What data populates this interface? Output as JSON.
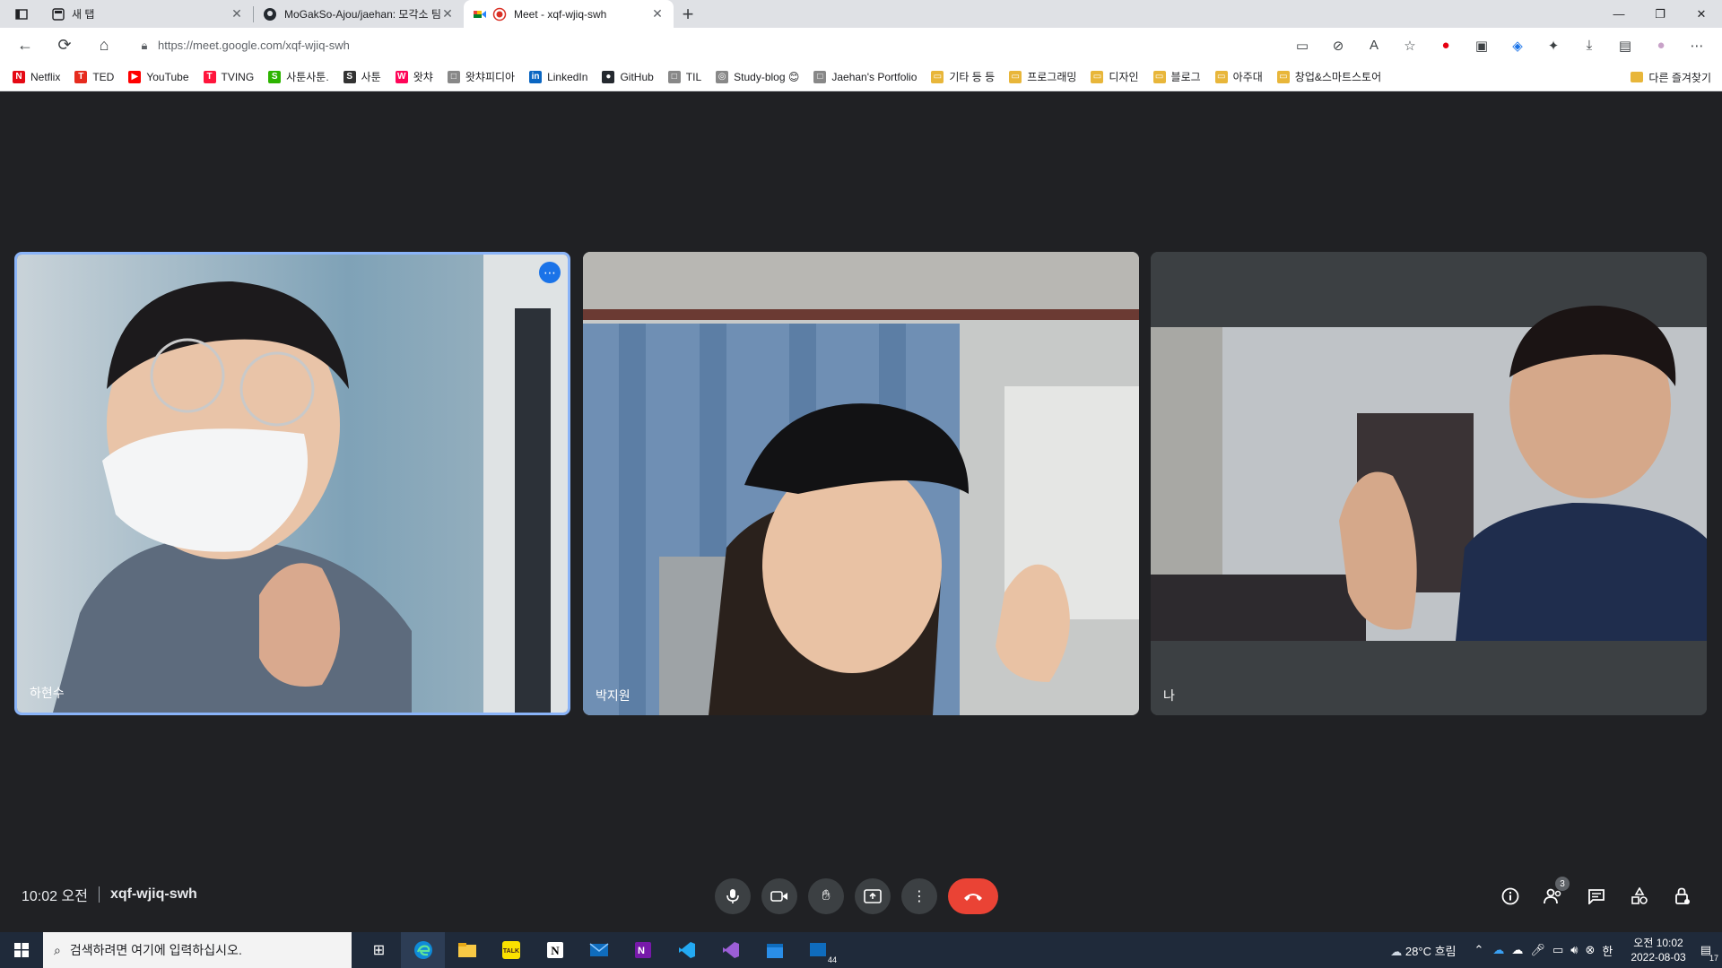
{
  "tabs": [
    {
      "title": "새 탭"
    },
    {
      "title": "MoGakSo-Ajou/jaehan: 모각소 팀"
    },
    {
      "title": "Meet - xqf-wjiq-swh"
    }
  ],
  "address": {
    "url": "https://meet.google.com/xqf-wjiq-swh"
  },
  "bookmarks": [
    {
      "label": "Netflix",
      "icon": "N",
      "color": "#e50914"
    },
    {
      "label": "TED",
      "icon": "T",
      "color": "#e62b1e"
    },
    {
      "label": "YouTube",
      "icon": "▶",
      "color": "#ff0000"
    },
    {
      "label": "TVING",
      "icon": "T",
      "color": "#ff153c"
    },
    {
      "label": "사툰사툰.",
      "icon": "S",
      "color": "#2db400"
    },
    {
      "label": "사툰",
      "icon": "S",
      "color": "#333333"
    },
    {
      "label": "왓챠",
      "icon": "W",
      "color": "#ff0558"
    },
    {
      "label": "왓챠피디아",
      "icon": "□",
      "color": "#888888"
    },
    {
      "label": "LinkedIn",
      "icon": "in",
      "color": "#0a66c2"
    },
    {
      "label": "GitHub",
      "icon": "●",
      "color": "#24292f"
    },
    {
      "label": "TIL",
      "icon": "□",
      "color": "#888888"
    },
    {
      "label": "Study-blog 😊",
      "icon": "◎",
      "color": "#888888"
    },
    {
      "label": "Jaehan's Portfolio",
      "icon": "□",
      "color": "#888888"
    },
    {
      "label": "기타 등 등",
      "icon": "▭",
      "color": "#e8b63a"
    },
    {
      "label": "프로그래밍",
      "icon": "▭",
      "color": "#e8b63a"
    },
    {
      "label": "디자인",
      "icon": "▭",
      "color": "#e8b63a"
    },
    {
      "label": "블로그",
      "icon": "▭",
      "color": "#e8b63a"
    },
    {
      "label": "아주대",
      "icon": "▭",
      "color": "#e8b63a"
    },
    {
      "label": "창업&스마트스토어",
      "icon": "▭",
      "color": "#e8b63a"
    }
  ],
  "other_bookmarks": "다른 즐겨찾기",
  "participants": [
    {
      "name": "하현수"
    },
    {
      "name": "박지원"
    },
    {
      "name": "나"
    }
  ],
  "meeting": {
    "time": "10:02 오전",
    "code": "xqf-wjiq-swh",
    "people_count": "3"
  },
  "taskbar": {
    "search_placeholder": "검색하려면 여기에 입력하십시오.",
    "weather": "28°C 흐림",
    "clock_time": "오전 10:02",
    "clock_date": "2022-08-03",
    "notifications": "17",
    "mail_badge": "44"
  }
}
